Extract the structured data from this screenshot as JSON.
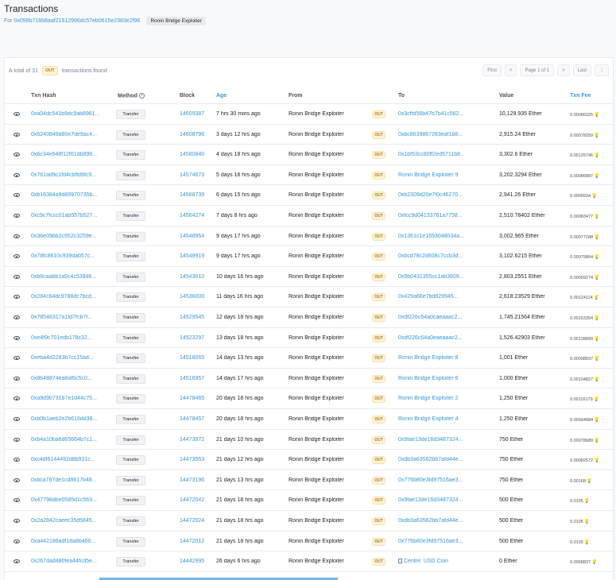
{
  "header": {
    "title": "Transactions",
    "for_label": "For",
    "address": "0x098b716b8aaf21512996dc57eb0615e2383e2f96",
    "tag": "Ronin Bridge Exploiter"
  },
  "summary": {
    "prefix": "A total of 31",
    "badge": "OUT",
    "suffix": "transactions found"
  },
  "pager": {
    "first": "First",
    "prev": "<",
    "page": "Page 1 of 1",
    "next": ">",
    "last": "Last",
    "more": "⋮"
  },
  "columns": {
    "txn_hash": "Txn Hash",
    "method": "Method",
    "block": "Block",
    "age": "Age",
    "from": "From",
    "to": "To",
    "value": "Value",
    "fee": "Txn Fee"
  },
  "colors": {
    "link": "#3498db",
    "out_badge_bg": "#fef3d7",
    "out_badge_text": "#a87b1f"
  },
  "rows": [
    {
      "hash": "0xa04dc541b9dc9ab8961...",
      "method": "Transfer",
      "block": "14609387",
      "age": "7 hrs 30 mins ago",
      "from": "Ronin Bridge Exploiter",
      "dir": "OUT",
      "to": "0x3cffd56b47b7b41c562...",
      "value": "10,129.935 Ether",
      "fee": "0.00086325"
    },
    {
      "hash": "0x6240849d80e7de9ac4...",
      "method": "Transfer",
      "block": "14608796",
      "age": "3 days 12 hrs ago",
      "from": "Ronin Bridge Exploiter",
      "dir": "OUT",
      "to": "0xbc8639867283eaf1b8...",
      "value": "2,915.24 Ether",
      "fee": "0.00078259"
    },
    {
      "hash": "0x6c34e648f12f61db899...",
      "method": "Transfer",
      "block": "14580840",
      "age": "4 days 18 hrs ago",
      "from": "Ronin Bridge Exploiter",
      "dir": "OUT",
      "to": "0x1bf53cc80ff2ed5711b8...",
      "value": "3,302.6 Ether",
      "fee": "0.00125746"
    },
    {
      "hash": "0x761ad9c1fd4cbffd9fc9...",
      "method": "Transfer",
      "block": "14574673",
      "age": "5 days 16 hrs ago",
      "from": "Ronin Bridge Exploiter",
      "dir": "OUT",
      "to": "Ronin Bridge Exploiter 9",
      "value": "3,202.3294 Ether",
      "fee": "0.00086887"
    },
    {
      "hash": "0xb16384a9d89970735b...",
      "method": "Transfer",
      "block": "14568739",
      "age": "6 days 15 hrs ago",
      "from": "Ronin Bridge Exploiter",
      "dir": "OUT",
      "to": "0xb2309d20e7f0c46270...",
      "value": "2,941.26 Ether",
      "fee": "0.0009934"
    },
    {
      "hash": "0xc9c7fccc01ab557b527...",
      "method": "Transfer",
      "block": "14564274",
      "age": "7 days 8 hrs ago",
      "from": "Ronin Bridge Exploiter",
      "dir": "OUT",
      "to": "0xfcc9d04133761a7758...",
      "value": "2,510.78402 Ether",
      "fee": "0.00083477"
    },
    {
      "hash": "0x3be09bb2c952c3259e...",
      "method": "Transfer",
      "block": "14548954",
      "age": "9 days 17 hrs ago",
      "from": "Ronin Bridge Exploiter",
      "dir": "OUT",
      "to": "0x1361c1e1693048034a...",
      "value": "3,002.965 Ether",
      "fee": "0.00077188"
    },
    {
      "hash": "0x78fc8610c939da057c...",
      "method": "Transfer",
      "block": "14548919",
      "age": "9 days 17 hrs ago",
      "from": "Ronin Bridge Exploiter",
      "dir": "OUT",
      "to": "0xbcd78c2d608c7ccb3d...",
      "value": "3,102.6215 Ether",
      "fee": "0.00075864"
    },
    {
      "hash": "0xb6caabb1a5c4c53846...",
      "method": "Transfer",
      "block": "14543010",
      "age": "10 days 16 hrs ago",
      "from": "Ronin Bridge Exploiter",
      "dir": "OUT",
      "to": "0x5b0431355cc1ab3609...",
      "value": "2,803.2551 Ether",
      "fee": "0.00099274"
    },
    {
      "hash": "0x284c64dc9788dc7bcd...",
      "method": "Transfer",
      "block": "14536000",
      "age": "11 days 16 hrs ago",
      "from": "Ronin Bridge Exploiter",
      "dir": "OUT",
      "to": "0x429a66e7bd829945...",
      "value": "2,618.23529 Ether",
      "fee": "0.00124114"
    },
    {
      "hash": "0x78546317a1fd7fcb7f...",
      "method": "Transfer",
      "block": "14529545",
      "age": "12 days 18 hrs ago",
      "from": "Ronin Bridge Exploiter",
      "dir": "OUT",
      "to": "0xdf226c64a0caeaaac2...",
      "value": "1,745.21564 Ether",
      "fee": "0.00153354"
    },
    {
      "hash": "0xe4f9c701edb178c32...",
      "method": "Transfer",
      "block": "14523297",
      "age": "13 days 18 hrs ago",
      "from": "Ronin Bridge Exploiter",
      "dir": "OUT",
      "to": "0xdf226c64a0eaeaaac2...",
      "value": "1,526.42903 Ether",
      "fee": "0.00128899"
    },
    {
      "hash": "0xeba4d2283b7cc15ad...",
      "method": "Transfer",
      "block": "14518065",
      "age": "14 days 13 hrs ago",
      "from": "Ronin Bridge Exploiter",
      "dir": "OUT",
      "to": "Ronin Bridge Exploiter 8",
      "value": "1,001 Ether",
      "fee": "0.00098597"
    },
    {
      "hash": "0x8b48874ea8af6c5c0...",
      "method": "Transfer",
      "block": "14516957",
      "age": "14 days 17 hrs ago",
      "from": "Ronin Bridge Exploiter",
      "dir": "OUT",
      "to": "Ronin Bridge Exploiter 6",
      "value": "1,000 Ether",
      "fee": "0.00104827"
    },
    {
      "hash": "0xa9d9b731b7e1d44c75...",
      "method": "Transfer",
      "block": "14478465",
      "age": "20 days 18 hrs ago",
      "from": "Ronin Bridge Exploiter",
      "dir": "OUT",
      "to": "Ronin Bridge Exploiter 2",
      "value": "1,250 Ether",
      "fee": "0.00116179"
    },
    {
      "hash": "0xb0b1aeb2e2b616dd38...",
      "method": "Transfer",
      "block": "14478457",
      "age": "20 days 18 hrs ago",
      "from": "Ronin Bridge Exploiter",
      "dir": "OUT",
      "to": "Ronin Bridge Exploiter 4",
      "value": "1,250 Ether",
      "fee": "0.00094084"
    },
    {
      "hash": "0xb4a10ba6d65664b7c1...",
      "method": "Transfer",
      "block": "14473972",
      "age": "21 days 10 hrs ago",
      "from": "Ronin Bridge Exploiter",
      "dir": "OUT",
      "to": "0x9fae13de16d3487324...",
      "value": "750 Ether",
      "fee": "0.00078689"
    },
    {
      "hash": "0xc4df6144492d8b931c...",
      "method": "Transfer",
      "block": "14473553",
      "age": "21 days 12 hrs ago",
      "from": "Ronin Bridge Exploiter",
      "dir": "OUT",
      "to": "0xdb3a63562bb7afd44e...",
      "value": "750 Ether",
      "fee": "0.00082572"
    },
    {
      "hash": "0xbca767de1cd8617b48...",
      "method": "Transfer",
      "block": "14473196",
      "age": "21 days 13 hrs ago",
      "from": "Ronin Bridge Exploiter",
      "dir": "OUT",
      "to": "0x776b80e3fd97516ae3...",
      "value": "750 Ether",
      "fee": "0.00168"
    },
    {
      "hash": "0x47798dbe0585d1c563...",
      "method": "Transfer",
      "block": "14472042",
      "age": "21 days 18 hrs ago",
      "from": "Ronin Bridge Exploiter",
      "dir": "OUT",
      "to": "0x9fae13de16d3487324...",
      "value": "500 Ether",
      "fee": "0.0105"
    },
    {
      "hash": "0x2a2842caeec35d5845...",
      "method": "Transfer",
      "block": "14472024",
      "age": "21 days 18 hrs ago",
      "from": "Ronin Bridge Exploiter",
      "dir": "OUT",
      "to": "0xdb3a63562bb7afd44e...",
      "value": "500 Ether",
      "fee": "0.0105"
    },
    {
      "hash": "0xa442188adf18a8b460...",
      "method": "Transfer",
      "block": "14472012",
      "age": "21 days 18 hrs ago",
      "from": "Ronin Bridge Exploiter",
      "dir": "OUT",
      "to": "0x776b80e3fd97516ae3...",
      "value": "500 Ether",
      "fee": "0.0105"
    },
    {
      "hash": "0x267dad480fea44fcd5e...",
      "method": "Transfer",
      "block": "14442995",
      "age": "26 days 6 hrs ago",
      "from": "Ronin Bridge Exploiter",
      "dir": "OUT",
      "to": "Centre: USD Coin",
      "value": "0 Ether",
      "fee": "0.0068837",
      "to_is_contract": true
    }
  ]
}
